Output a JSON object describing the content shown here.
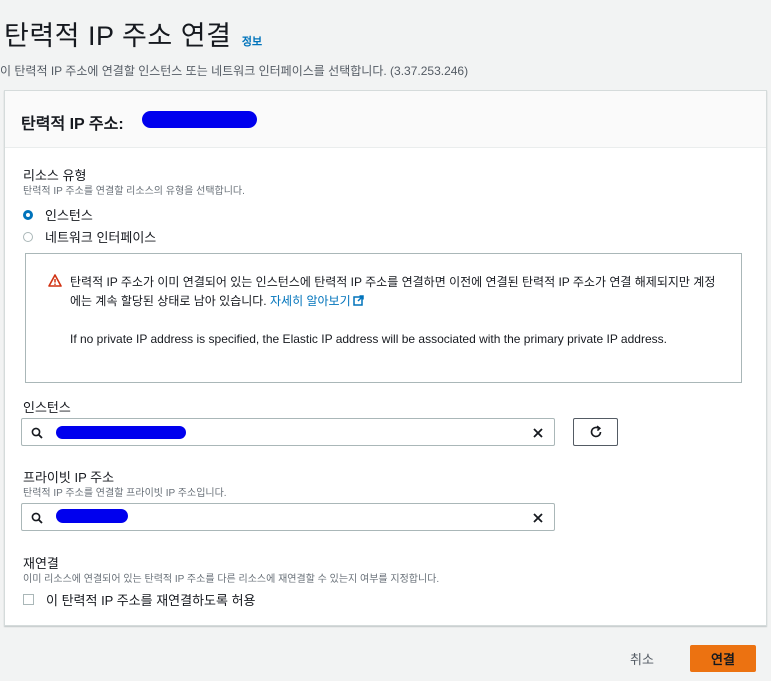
{
  "header": {
    "title": "탄력적 IP 주소 연결",
    "info_link": "정보",
    "description": "이 탄력적 IP 주소에 연결할 인스턴스 또는 네트워크 인터페이스를 선택합니다. (3.37.253.246)"
  },
  "panel": {
    "title": "탄력적 IP 주소:"
  },
  "resource_type": {
    "label": "리소스 유형",
    "description": "탄력적 IP 주소를 연결할 리소스의 유형을 선택합니다.",
    "options": [
      {
        "label": "인스턴스",
        "checked": true
      },
      {
        "label": "네트워크 인터페이스",
        "checked": false
      }
    ]
  },
  "alert": {
    "text": "탄력적 IP 주소가 이미 연결되어 있는 인스턴스에 탄력적 IP 주소를 연결하면 이전에 연결된 탄력적 IP 주소가 연결 해제되지만 계정에는 계속 할당된 상태로 남아 있습니다.",
    "learn_more": "자세히 알아보기",
    "text2": "If no private IP address is specified, the Elastic IP address will be associated with the primary private IP address.",
    "icon": "warning-icon",
    "icon_color": "#d13212"
  },
  "instance": {
    "label": "인스턴스"
  },
  "private_ip": {
    "label": "프라이빗 IP 주소",
    "description": "탄력적 IP 주소를 연결할 프라이빗 IP 주소입니다."
  },
  "reassociate": {
    "label": "재연결",
    "description": "이미 리소스에 연결되어 있는 탄력적 IP 주소를 다른 리소스에 재연결할 수 있는지 여부를 지정합니다.",
    "checkbox_label": "이 탄력적 IP 주소를 재연결하도록 허용",
    "checked": false
  },
  "footer": {
    "cancel_label": "취소",
    "submit_label": "연결"
  },
  "colors": {
    "accent": "#0073bb",
    "primary_button": "#ec7211",
    "redaction": "#0000ee"
  }
}
